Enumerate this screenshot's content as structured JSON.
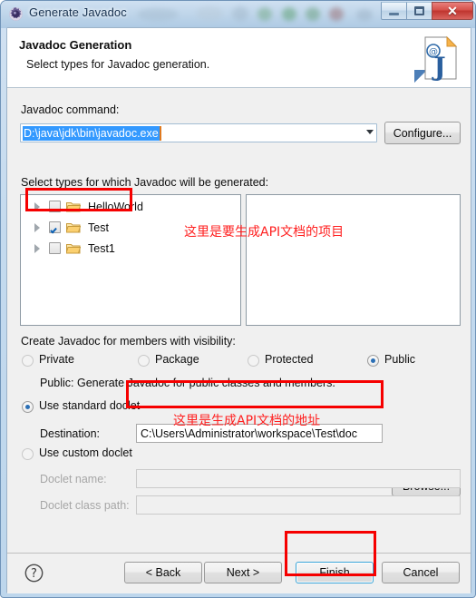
{
  "window": {
    "title": "Generate Javadoc",
    "icon": "javadoc-gear-icon",
    "controls": {
      "minimize": "—",
      "maximize": "□",
      "close": "✕"
    }
  },
  "banner": {
    "title": "Javadoc Generation",
    "subtitle": "Select types for Javadoc generation.",
    "icon": "javadoc-page-icon"
  },
  "command": {
    "label": "Javadoc command:",
    "value": "D:\\java\\jdk\\bin\\javadoc.exe",
    "selected": true,
    "configure_button": "Configure..."
  },
  "types": {
    "label": "Select types for which Javadoc will be generated:",
    "items": [
      {
        "name": "HelloWorld",
        "checked": false,
        "expandable": true
      },
      {
        "name": "Test",
        "checked": true,
        "expandable": true
      },
      {
        "name": "Test1",
        "checked": false,
        "expandable": true
      }
    ],
    "right_panel_items": []
  },
  "visibility": {
    "label": "Create Javadoc for members with visibility:",
    "options": [
      {
        "label": "Private",
        "selected": false
      },
      {
        "label": "Package",
        "selected": false
      },
      {
        "label": "Protected",
        "selected": false
      },
      {
        "label": "Public",
        "selected": true
      }
    ],
    "description": "Public: Generate Javadoc for public classes and members."
  },
  "doclet": {
    "standard_label": "Use standard doclet",
    "standard_selected": true,
    "destination_label": "Destination:",
    "destination_value": "C:\\Users\\Administrator\\workspace\\Test\\doc",
    "browse_button": "Browse...",
    "custom_label": "Use custom doclet",
    "custom_selected": false,
    "doclet_name_label": "Doclet name:",
    "doclet_name_value": "",
    "doclet_class_path_label": "Doclet class path:",
    "doclet_class_path_value": ""
  },
  "buttons": {
    "help": "?",
    "back": "< Back",
    "next": "Next >",
    "finish": "Finish",
    "cancel": "Cancel",
    "focused": "Finish"
  },
  "annotations": [
    {
      "text": "这里是要生成API文档的项目",
      "target": "tree-item-test"
    },
    {
      "text": "这里是生成API文档的地址",
      "target": "destination-field"
    }
  ],
  "colors": {
    "annotation_red": "#ff2020",
    "box_red": "#f60000",
    "selection_blue": "#3399ff",
    "focus_blue": "#3ba5d8"
  }
}
